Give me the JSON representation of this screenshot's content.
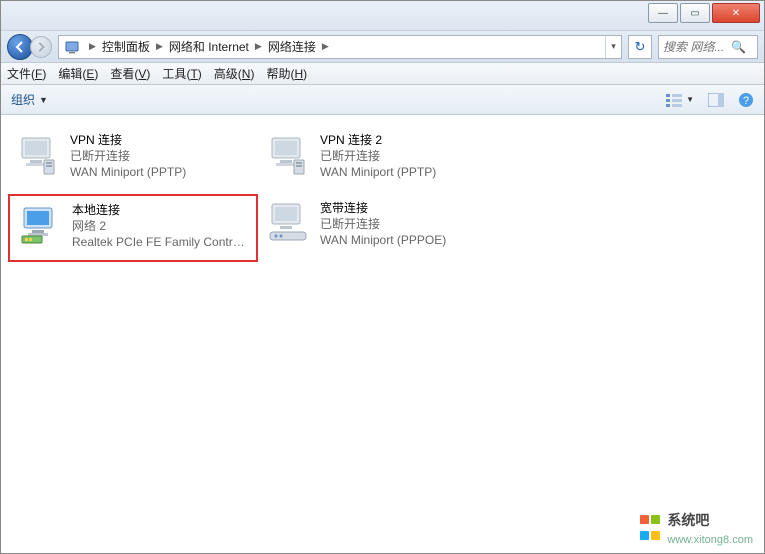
{
  "window": {
    "buttons": {
      "min": "—",
      "max": "▭",
      "close": "✕"
    }
  },
  "address": {
    "crumbs": [
      "控制面板",
      "网络和 Internet",
      "网络连接"
    ],
    "refresh_icon": "↻"
  },
  "search": {
    "placeholder": "搜索 网络...",
    "icon": "🔍"
  },
  "menubar": {
    "items": [
      {
        "label": "文件",
        "key": "F"
      },
      {
        "label": "编辑",
        "key": "E"
      },
      {
        "label": "查看",
        "key": "V"
      },
      {
        "label": "工具",
        "key": "T"
      },
      {
        "label": "高级",
        "key": "N"
      },
      {
        "label": "帮助",
        "key": "H"
      }
    ]
  },
  "toolbar": {
    "organize": "组织"
  },
  "connections": [
    {
      "id": "vpn1",
      "name": "VPN 连接",
      "status": "已断开连接",
      "device": "WAN Miniport (PPTP)",
      "highlighted": false,
      "icon": "monitor"
    },
    {
      "id": "vpn2",
      "name": "VPN 连接 2",
      "status": "已断开连接",
      "device": "WAN Miniport (PPTP)",
      "highlighted": false,
      "icon": "monitor"
    },
    {
      "id": "local",
      "name": "本地连接",
      "status": "网络  2",
      "device": "Realtek PCIe FE Family Control...",
      "highlighted": true,
      "icon": "monitor-nic"
    },
    {
      "id": "broadband",
      "name": "宽带连接",
      "status": "已断开连接",
      "device": "WAN Miniport (PPPOE)",
      "highlighted": false,
      "icon": "monitor-modem"
    }
  ],
  "watermark": {
    "text": "系统吧",
    "url": "www.xitong8.com"
  }
}
